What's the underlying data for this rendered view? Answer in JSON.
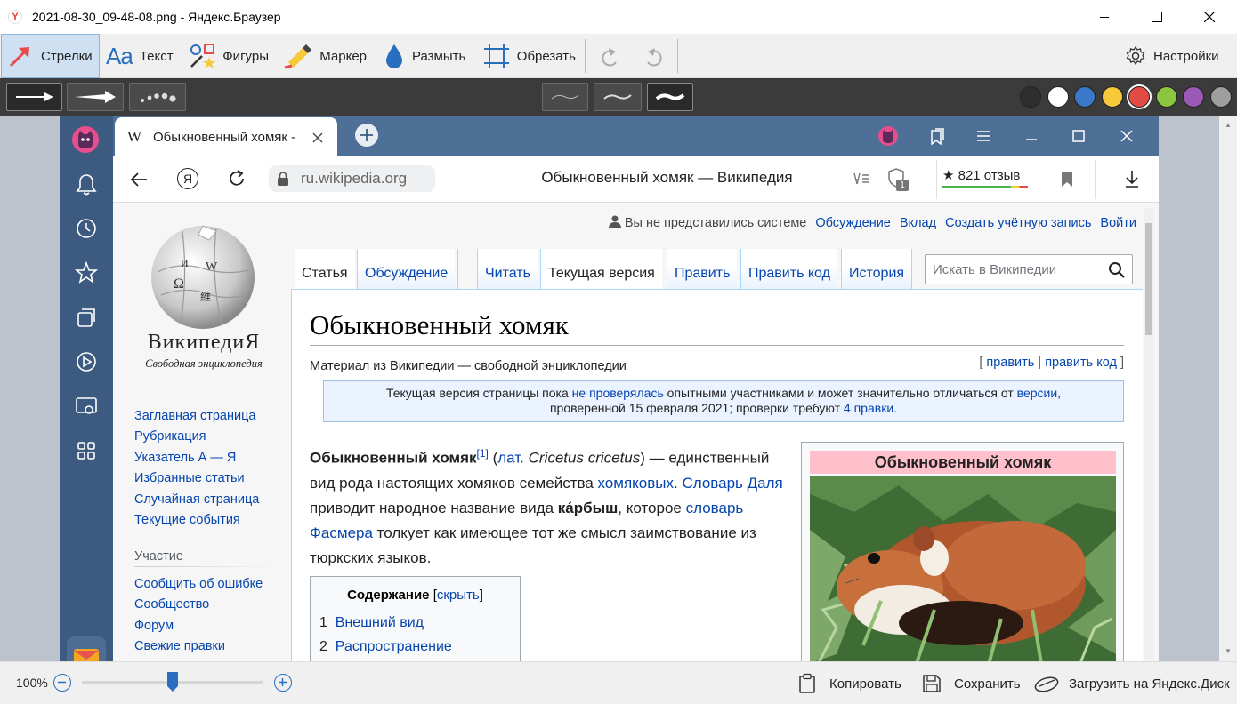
{
  "window": {
    "title": "2021-08-30_09-48-08.png - Яндекс.Браузер",
    "logo_letter": "Y"
  },
  "toolbar": {
    "arrows": "Стрелки",
    "text": "Текст",
    "shapes": "Фигуры",
    "marker": "Маркер",
    "blur": "Размыть",
    "crop": "Обрезать",
    "settings": "Настройки"
  },
  "colors": {
    "palette": [
      "#2e2e2e",
      "#ffffff",
      "#3a78c9",
      "#f5c93a",
      "#e24a43",
      "#8cc63f",
      "#9b59b6",
      "#9e9e9e"
    ],
    "selected": "#e24a43",
    "accent": "#e84b4b"
  },
  "browser": {
    "tab_title": "Обыкновенный хомяк -",
    "tab_favicon": "W",
    "address": "ru.wikipedia.org",
    "page_title": "Обыкновенный хомяк — Википедия",
    "reviews": "★ 821 отзыв",
    "badge_count": "1"
  },
  "wiki": {
    "logo_word": "ВикипедиЯ",
    "logo_sub": "Свободная энциклопедия",
    "personal": {
      "not_logged": "Вы не представились системе",
      "talk": "Обсуждение",
      "contrib": "Вклад",
      "create": "Создать учётную запись",
      "login": "Войти"
    },
    "tabs": [
      "Статья",
      "Обсуждение",
      "Читать",
      "Текущая версия",
      "Править",
      "Править код",
      "История"
    ],
    "search_placeholder": "Искать в Википедии",
    "nav": [
      "Заглавная страница",
      "Рубрикация",
      "Указатель А — Я",
      "Избранные статьи",
      "Случайная страница",
      "Текущие события"
    ],
    "participation_heading": "Участие",
    "participation": [
      "Сообщить об ошибке",
      "Сообщество",
      "Форум",
      "Свежие правки"
    ],
    "heading": "Обыкновенный хомяк",
    "from": "Материал из Википедии — свободной энциклопедии",
    "edit_links": {
      "open": "[",
      "edit": "править",
      "sep": "|",
      "edit_code": "править код",
      "close": "]"
    },
    "notice": {
      "p1": "Текущая версия страницы пока ",
      "l1": "не проверялась",
      "p2": " опытными участниками и может значительно отличаться от ",
      "l2": "версии",
      "p3": ",",
      "p4": "проверенной 15 февраля 2021; проверки требуют ",
      "l3": "4 правки",
      "p5": "."
    },
    "intro": {
      "bold": "Обыкновенный хомяк",
      "ref": "[1]",
      "t1": " (",
      "lat": "лат.",
      "t2": " ",
      "sci": "Cricetus cricetus",
      "t3": ") — единственный вид рода настоящих хомяков семейства ",
      "fam": "хомяковых",
      "t4": ". ",
      "dal": "Словарь Даля",
      "t5": " приводит народное название вида ",
      "kar": "ка́рбыш",
      "t6": ", которое ",
      "fas": "словарь Фасмера",
      "t7": " толкует как имеющее тот же смысл заимствование из тюркских языков."
    },
    "toc": {
      "title": "Содержание",
      "hide_open": "[",
      "hide": "скрыть",
      "hide_close": "]",
      "items": [
        {
          "num": "1",
          "label": "Внешний вид"
        },
        {
          "num": "2",
          "label": "Распространение"
        }
      ]
    },
    "infobox_title": "Обыкновенный хомяк"
  },
  "bottom": {
    "zoom": "100%",
    "zoom_level": 0.5,
    "copy": "Копировать",
    "save": "Сохранить",
    "upload": "Загрузить на Яндекс.Диск"
  }
}
